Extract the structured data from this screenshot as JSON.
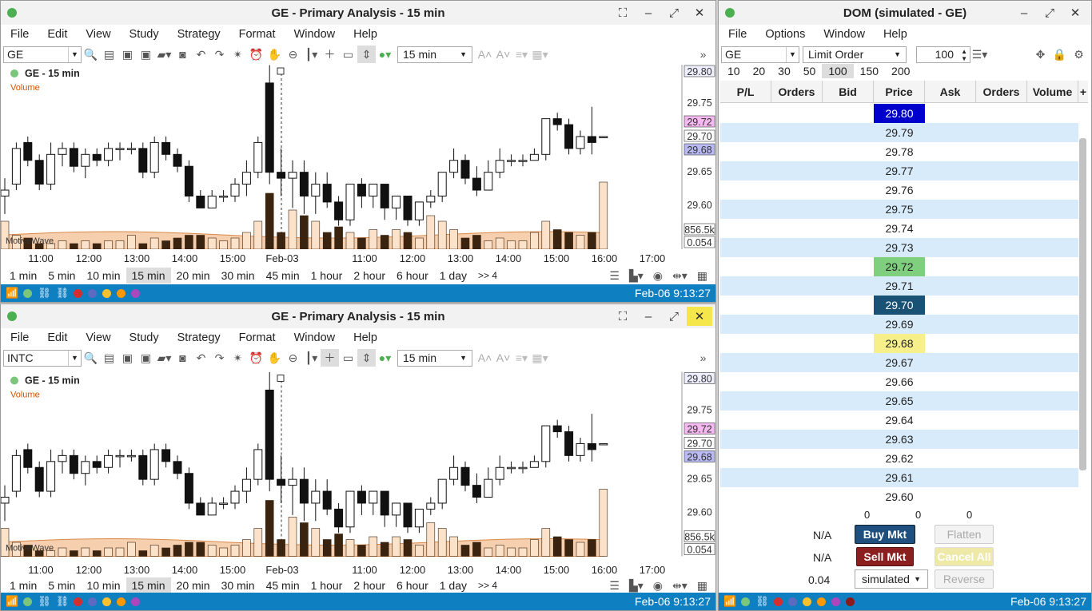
{
  "chart_windows": [
    {
      "title": "GE - Primary Analysis - 15 min",
      "symbol": "GE",
      "interval": "15 min",
      "chart_label": "GE - 15 min",
      "volume_label": "Volume",
      "indicator_label": "MotiveWave",
      "status_time": "Feb-06 9:13:27"
    },
    {
      "title": "GE - Primary Analysis - 15 min",
      "symbol": "INTC",
      "interval": "15 min",
      "chart_label": "GE - 15 min",
      "volume_label": "Volume",
      "indicator_label": "MotiveWave",
      "status_time": "Feb-06 9:13:27"
    }
  ],
  "menu": [
    "File",
    "Edit",
    "View",
    "Study",
    "Strategy",
    "Format",
    "Window",
    "Help"
  ],
  "intervals": [
    "1 min",
    "5 min",
    "10 min",
    "15 min",
    "20 min",
    "30 min",
    "45 min",
    "1 hour",
    "2 hour",
    "6 hour",
    "1 day",
    ">> 4"
  ],
  "selected_interval": "15 min",
  "time_labels": [
    "11:00",
    "12:00",
    "13:00",
    "14:00",
    "15:00",
    "Feb-03",
    "11:00",
    "12:00",
    "13:00",
    "14:00",
    "15:00",
    "16:00",
    "17:00"
  ],
  "price_labels": [
    "29.80",
    "29.75",
    "29.72",
    "29.70",
    "29.68",
    "29.65",
    "29.60",
    "856.5k",
    "0.054"
  ],
  "status_colors": [
    "#7bc67b",
    "#4caf50",
    "#d32f2f",
    "#5c6bc0",
    "#fbc02d",
    "#ff9800",
    "#ab47bc"
  ],
  "dom": {
    "title": "DOM (simulated - GE)",
    "menu": [
      "File",
      "Options",
      "Window",
      "Help"
    ],
    "symbol": "GE",
    "order_type": "Limit Order",
    "quantity": "100",
    "quick_sizes": [
      "10",
      "20",
      "30",
      "50",
      "100",
      "150",
      "200"
    ],
    "selected_size": "100",
    "columns": [
      "P/L",
      "Orders",
      "Bid",
      "Price",
      "Ask",
      "Orders",
      "Volume"
    ],
    "prices": [
      "29.80",
      "29.79",
      "29.78",
      "29.77",
      "29.76",
      "29.75",
      "29.74",
      "29.73",
      "29.72",
      "29.71",
      "29.70",
      "29.69",
      "29.68",
      "29.67",
      "29.66",
      "29.65",
      "29.64",
      "29.63",
      "29.62",
      "29.61",
      "29.60"
    ],
    "highlight": {
      "29.80": "#0000cc",
      "29.72": "#7fcf7f",
      "29.70": "#1a5276",
      "29.68": "#f7f08a"
    },
    "totals": [
      "0",
      "0",
      "0"
    ],
    "pl_buy": "N/A",
    "pl_sell": "N/A",
    "buy_label": "Buy Mkt",
    "sell_label": "Sell Mkt",
    "flatten_label": "Flatten",
    "cancel_label": "Cancel All",
    "reverse_label": "Reverse",
    "tick": "0.04",
    "account": "simulated",
    "status_time": "Feb-06 9:13:27",
    "status_colors": [
      "#7bc67b",
      "#d32f2f",
      "#5c6bc0",
      "#fbc02d",
      "#ff9800",
      "#ab47bc",
      "#8b1a1a"
    ]
  }
}
